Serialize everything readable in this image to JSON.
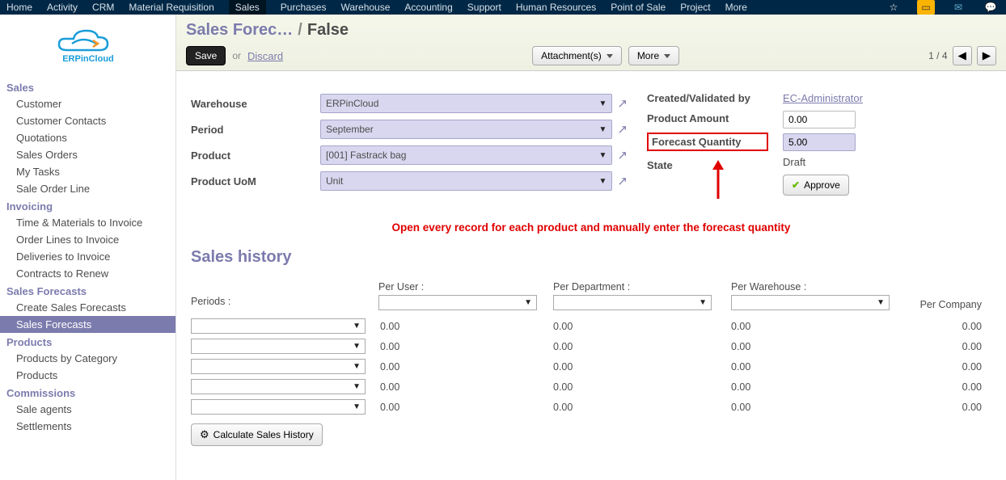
{
  "topbar": {
    "items": [
      "Home",
      "Activity",
      "CRM",
      "Material Requisition",
      "Sales",
      "Purchases",
      "Warehouse",
      "Accounting",
      "Support",
      "Human Resources",
      "Point of Sale",
      "Project",
      "More"
    ],
    "active_index": 4
  },
  "logo_text": "ERPinCloud",
  "sidebar": {
    "sections": [
      {
        "title": "Sales",
        "items": [
          "Customer",
          "Customer Contacts",
          "Quotations",
          "Sales Orders",
          "My Tasks",
          "Sale Order Line"
        ]
      },
      {
        "title": "Invoicing",
        "items": [
          "Time & Materials to Invoice",
          "Order Lines to Invoice",
          "Deliveries to Invoice",
          "Contracts to Renew"
        ]
      },
      {
        "title": "Sales Forecasts",
        "items": [
          "Create Sales Forecasts",
          "Sales Forecasts"
        ],
        "active_item": "Sales Forecasts"
      },
      {
        "title": "Products",
        "items": [
          "Products by Category",
          "Products"
        ]
      },
      {
        "title": "Commissions",
        "items": [
          "Sale agents",
          "Settlements"
        ]
      }
    ]
  },
  "breadcrumb": {
    "root": "Sales Forec…",
    "slash": "/",
    "current": "False"
  },
  "controls": {
    "save": "Save",
    "or": "or",
    "discard": "Discard",
    "attachments": "Attachment(s)",
    "more": "More",
    "paging": "1 / 4"
  },
  "form": {
    "warehouse_label": "Warehouse",
    "warehouse_value": "ERPinCloud",
    "period_label": "Period",
    "period_value": "September",
    "product_label": "Product",
    "product_value": "[001] Fastrack bag",
    "uom_label": "Product UoM",
    "uom_value": "Unit",
    "created_label": "Created/Validated by",
    "created_value": "EC-Administrator",
    "amount_label": "Product Amount",
    "amount_value": "0.00",
    "forecast_label": "Forecast Quantity",
    "forecast_value": "5.00",
    "state_label": "State",
    "state_value": "Draft",
    "approve": "Approve"
  },
  "instruction": "Open every record for each product and manually enter the forecast quantity",
  "history": {
    "title": "Sales history",
    "periods_label": "Periods :",
    "per_user": "Per User :",
    "per_dept": "Per Department :",
    "per_wh": "Per Warehouse :",
    "per_comp": "Per Company",
    "rows": [
      {
        "user": "0.00",
        "dept": "0.00",
        "wh": "0.00",
        "comp": "0.00"
      },
      {
        "user": "0.00",
        "dept": "0.00",
        "wh": "0.00",
        "comp": "0.00"
      },
      {
        "user": "0.00",
        "dept": "0.00",
        "wh": "0.00",
        "comp": "0.00"
      },
      {
        "user": "0.00",
        "dept": "0.00",
        "wh": "0.00",
        "comp": "0.00"
      },
      {
        "user": "0.00",
        "dept": "0.00",
        "wh": "0.00",
        "comp": "0.00"
      }
    ],
    "calc": "Calculate Sales History"
  }
}
